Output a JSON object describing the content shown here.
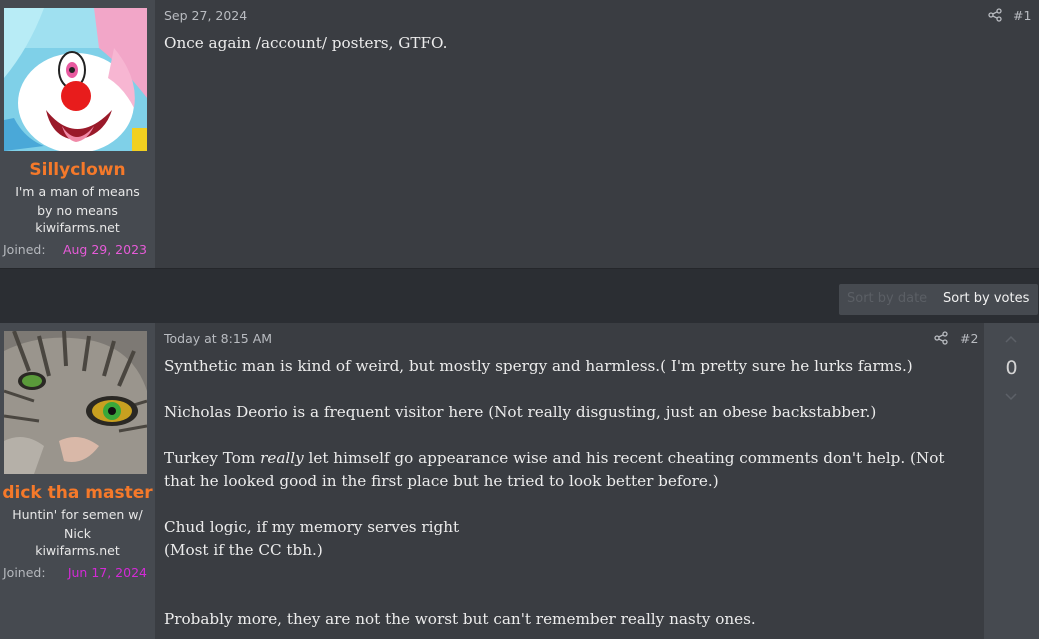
{
  "posts": [
    {
      "date": "Sep 27, 2024",
      "number": "#1",
      "username": "Sillyclown",
      "user_title": "I'm a man of means by no means",
      "site": "kiwifarms.net",
      "joined_label": "Joined:",
      "joined_date": "Aug 29, 2023",
      "joined_color": "#e65bd8",
      "body": [
        "Once again /account/ posters, GTFO."
      ]
    },
    {
      "date": "Today at 8:15 AM",
      "number": "#2",
      "username": "dick tha master",
      "user_title": "Huntin' for semen w/ Nick",
      "site": "kiwifarms.net",
      "joined_label": "Joined:",
      "joined_date": "Jun 17, 2024",
      "joined_color": "#d32ad6",
      "vote_count": "0",
      "body": {
        "p1": "Synthetic man is kind of weird, but mostly spergy and harmless.( I'm pretty sure he lurks farms.)",
        "p2": "Nicholas Deorio is a frequent visitor here (Not really disgusting, just an obese backstabber.)",
        "p3_before": "Turkey Tom ",
        "p3_em": "really",
        "p3_after": " let himself go appearance wise and his recent cheating comments don't help. (Not that he looked good in the first place but he tried to look better before.)",
        "p4_line1": "Chud logic, if my memory serves right",
        "p4_line2": "(Most if the CC tbh.)",
        "p5": "Probably more, they are not the worst but can't remember really nasty ones."
      }
    }
  ],
  "sort": {
    "by_date": "Sort by date",
    "by_votes": "Sort by votes"
  },
  "colors": {
    "username": "#f5792a",
    "background": "#2b2e33",
    "post_bg": "#3a3d42",
    "sidebar_bg": "#464a50"
  },
  "icons": {
    "share": "share-icon",
    "upvote": "chevron-up-icon",
    "downvote": "chevron-down-icon"
  }
}
